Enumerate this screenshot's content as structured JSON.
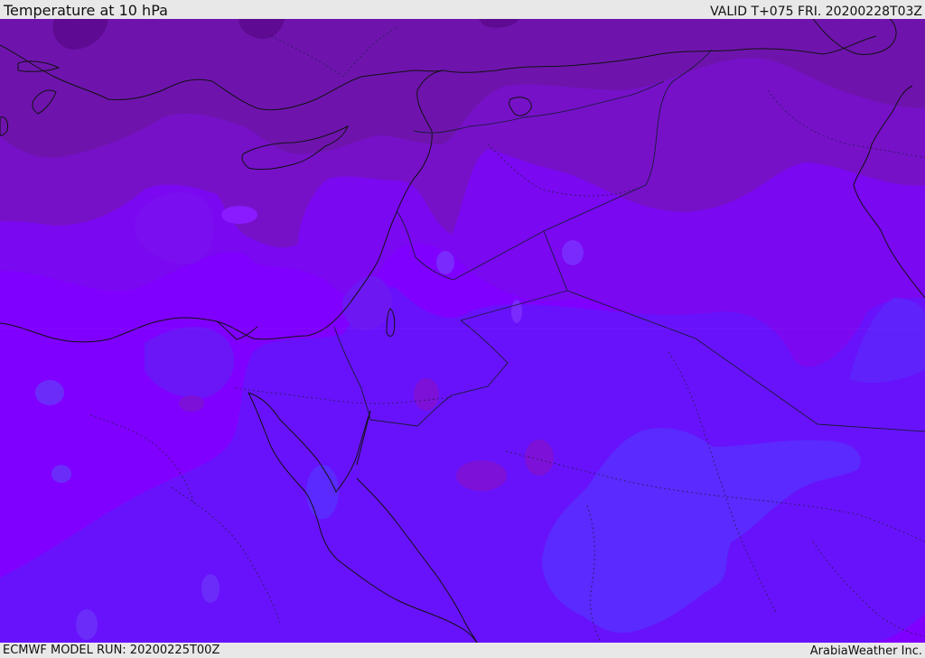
{
  "header": {
    "title": "Temperature at 10 hPa",
    "valid_time": "VALID T+075 FRI. 20200228T03Z"
  },
  "footer": {
    "model_run": "ECMWF MODEL RUN: 20200225T00Z",
    "credit": "ArabiaWeather Inc."
  },
  "map": {
    "colors": {
      "coldest": "#5a0a99",
      "cold": "#7811b5",
      "cool": "#7a00e6",
      "mid": "#8000ff",
      "warm": "#6a12f7",
      "warmest": "#5a2aff",
      "coast_line": "#111111",
      "border_line": "#1a1a3a"
    }
  }
}
